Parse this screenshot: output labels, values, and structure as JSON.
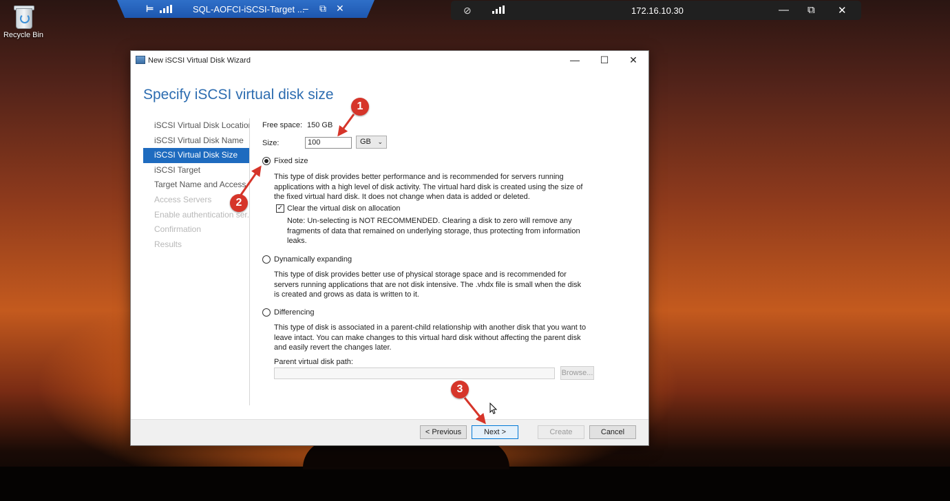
{
  "desktop": {
    "recycle_bin_label": "Recycle Bin"
  },
  "rdp_bar_primary": {
    "title": "SQL-AOFCI-iSCSI-Target ...",
    "pin_icon": "pin-icon",
    "minimize_icon": "–",
    "restore_icon": "⧉",
    "close_icon": "✕"
  },
  "rdp_bar_secondary": {
    "address": "172.16.10.30",
    "minimize_icon": "—",
    "restore_icon": "⧉",
    "close_icon": "✕"
  },
  "window": {
    "title": "New iSCSI Virtual Disk Wizard",
    "minimize": "—",
    "maximize": "☐",
    "close": "✕"
  },
  "page_heading": "Specify iSCSI virtual disk size",
  "nav": {
    "items": [
      {
        "label": "iSCSI Virtual Disk Location",
        "state": "normal"
      },
      {
        "label": "iSCSI Virtual Disk Name",
        "state": "normal"
      },
      {
        "label": "iSCSI Virtual Disk Size",
        "state": "active"
      },
      {
        "label": "iSCSI Target",
        "state": "normal"
      },
      {
        "label": "Target Name and Access",
        "state": "normal"
      },
      {
        "label": "Access Servers",
        "state": "disabled"
      },
      {
        "label": "Enable authentication ser...",
        "state": "disabled"
      },
      {
        "label": "Confirmation",
        "state": "disabled"
      },
      {
        "label": "Results",
        "state": "disabled"
      }
    ]
  },
  "size_section": {
    "free_space_label": "Free space:",
    "free_space_value": "150 GB",
    "size_label": "Size:",
    "size_value": "100",
    "unit": "GB"
  },
  "options": {
    "fixed": {
      "label": "Fixed size",
      "selected": true,
      "description": "This type of disk provides better performance and is recommended for servers running applications with a high level of disk activity. The virtual hard disk is created using the size of the fixed virtual hard disk. It does not change when data is added or deleted.",
      "clear_checkbox_label": "Clear the virtual disk on allocation",
      "clear_checked": true,
      "note": "Note: Un-selecting is NOT RECOMMENDED. Clearing a disk to zero will remove any fragments of data that remained on underlying storage, thus protecting from information leaks."
    },
    "dynamic": {
      "label": "Dynamically expanding",
      "selected": false,
      "description": "This type of disk provides better use of physical storage space and is recommended for servers running applications that are not disk intensive. The .vhdx file is small when the disk is created and grows as data is written to it."
    },
    "differencing": {
      "label": "Differencing",
      "selected": false,
      "description": "This type of disk is associated in a parent-child relationship with another disk that you want to leave intact. You can make changes to this virtual hard disk without affecting the parent disk and easily revert the changes later.",
      "parent_path_label": "Parent virtual disk path:",
      "parent_path_value": "",
      "browse_label": "Browse..."
    }
  },
  "footer_buttons": {
    "previous": "< Previous",
    "next": "Next >",
    "create": "Create",
    "cancel": "Cancel"
  },
  "callouts": [
    "1",
    "2",
    "3"
  ],
  "colors": {
    "accent": "#1e6bbf",
    "heading": "#2c6cb0",
    "callout": "#d6352a",
    "rdp_bar": "#1d57b0"
  }
}
